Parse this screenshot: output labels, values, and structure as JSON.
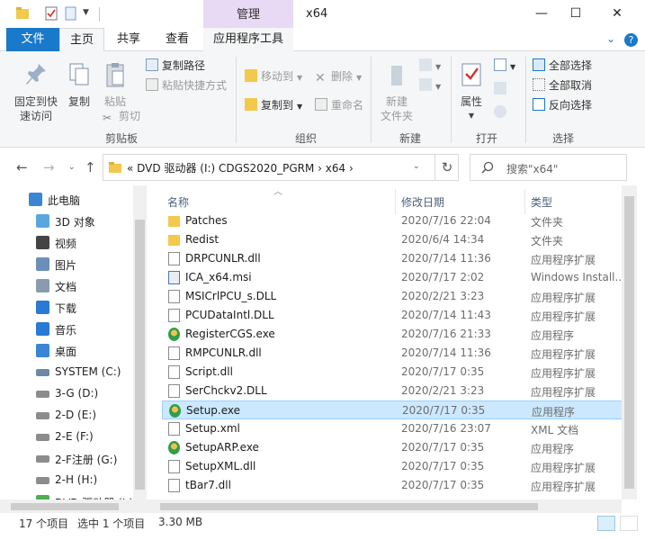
{
  "titlebar": {
    "context_tab": "管理",
    "window_title": "x64",
    "minimize": "—",
    "maximize": "☐",
    "close": "✕"
  },
  "tabs": {
    "file": "文件",
    "home": "主页",
    "share": "共享",
    "view": "查看",
    "app_tools": "应用程序工具"
  },
  "ribbon": {
    "clipboard": {
      "pin_line1": "固定到快",
      "pin_line2": "速访问",
      "copy": "复制",
      "paste": "粘贴",
      "copy_path": "复制路径",
      "paste_shortcut": "粘贴快捷方式",
      "cut": "剪切",
      "label": "剪贴板"
    },
    "organize": {
      "move_to": "移动到",
      "copy_to": "复制到",
      "delete": "删除",
      "rename": "重命名",
      "label": "组织"
    },
    "new": {
      "new_folder_line1": "新建",
      "new_folder_line2": "文件夹",
      "label": "新建"
    },
    "open": {
      "properties": "属性",
      "label": "打开"
    },
    "select": {
      "select_all": "全部选择",
      "select_none": "全部取消",
      "invert": "反向选择",
      "label": "选择"
    }
  },
  "address": {
    "path": "«  DVD 驱动器 (I:) CDGS2020_PGRM  ›  x64  ›",
    "search_placeholder": "搜索\"x64\""
  },
  "nav_pane": [
    {
      "label": "此电脑",
      "icon": "computer-icon"
    },
    {
      "label": "3D 对象",
      "icon": "3d-objects-icon"
    },
    {
      "label": "视频",
      "icon": "video-icon"
    },
    {
      "label": "图片",
      "icon": "pictures-icon"
    },
    {
      "label": "文档",
      "icon": "documents-icon"
    },
    {
      "label": "下载",
      "icon": "download-icon"
    },
    {
      "label": "音乐",
      "icon": "music-icon"
    },
    {
      "label": "桌面",
      "icon": "desktop-icon"
    },
    {
      "label": "SYSTEM (C:)",
      "icon": "system-drive-icon"
    },
    {
      "label": "3-G (D:)",
      "icon": "drive-icon"
    },
    {
      "label": "2-D (E:)",
      "icon": "drive-icon"
    },
    {
      "label": "2-E (F:)",
      "icon": "drive-icon"
    },
    {
      "label": "2-F注册 (G:)",
      "icon": "drive-icon"
    },
    {
      "label": "2-H (H:)",
      "icon": "drive-icon"
    },
    {
      "label": "DVD 驱动器 (I:)",
      "icon": "dvd-drive-icon"
    }
  ],
  "columns": {
    "name": "名称",
    "date": "修改日期",
    "type": "类型"
  },
  "files": [
    {
      "name": "Patches",
      "date": "2020/7/16 22:04",
      "type": "文件夹",
      "icon": "folder-icon"
    },
    {
      "name": "Redist",
      "date": "2020/6/4 14:34",
      "type": "文件夹",
      "icon": "folder-icon"
    },
    {
      "name": "DRPCUNLR.dll",
      "date": "2020/7/14 11:36",
      "type": "应用程序扩展",
      "icon": "dll-icon"
    },
    {
      "name": "ICA_x64.msi",
      "date": "2020/7/17 2:02",
      "type": "Windows Install...",
      "icon": "msi-icon"
    },
    {
      "name": "MSICrlPCU_s.DLL",
      "date": "2020/2/21 3:23",
      "type": "应用程序扩展",
      "icon": "dll-icon"
    },
    {
      "name": "PCUDataIntl.DLL",
      "date": "2020/7/14 11:43",
      "type": "应用程序扩展",
      "icon": "dll-icon"
    },
    {
      "name": "RegisterCGS.exe",
      "date": "2020/7/16 21:33",
      "type": "应用程序",
      "icon": "exe-icon"
    },
    {
      "name": "RMPCUNLR.dll",
      "date": "2020/7/14 11:36",
      "type": "应用程序扩展",
      "icon": "dll-icon"
    },
    {
      "name": "Script.dll",
      "date": "2020/7/17 0:35",
      "type": "应用程序扩展",
      "icon": "dll-icon"
    },
    {
      "name": "SerChckv2.DLL",
      "date": "2020/2/21 3:23",
      "type": "应用程序扩展",
      "icon": "dll-icon"
    },
    {
      "name": "Setup.exe",
      "date": "2020/7/17 0:35",
      "type": "应用程序",
      "icon": "exe-icon",
      "selected": true
    },
    {
      "name": "Setup.xml",
      "date": "2020/7/16 23:07",
      "type": "XML 文档",
      "icon": "xml-icon"
    },
    {
      "name": "SetupARP.exe",
      "date": "2020/7/17 0:35",
      "type": "应用程序",
      "icon": "exe-icon"
    },
    {
      "name": "SetupXML.dll",
      "date": "2020/7/17 0:35",
      "type": "应用程序扩展",
      "icon": "dll-icon"
    },
    {
      "name": "tBar7.dll",
      "date": "2020/7/17 0:35",
      "type": "应用程序扩展",
      "icon": "dll-icon"
    }
  ],
  "status": {
    "count": "17 个项目",
    "selected": "选中 1 个项目",
    "size": "3.30 MB"
  },
  "colors": {
    "accent": "#1979ca",
    "context_tab": "#e8d9f5",
    "selection": "#cce8ff",
    "folder": "#f2c94c"
  }
}
